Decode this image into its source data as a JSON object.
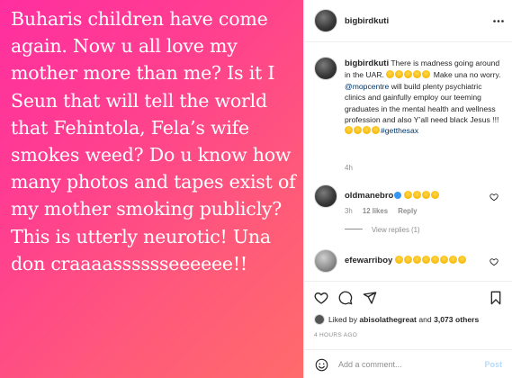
{
  "post": {
    "story_text": "Buharis children have come again. Now u all love my mother more than me? Is it I Seun that will tell the world that Fehintola, Fela’s wife smokes weed? Do u know how many photos and tapes exist of my mother smoking publicly? This is utterly neurotic! Una don craaaasssssseeeeee!!"
  },
  "header": {
    "username": "bigbirdkuti"
  },
  "caption": {
    "username": "bigbirdkuti",
    "text_a": "There is madness going around in the UAR.",
    "text_b": "Make una no worry.",
    "mention": "@mopcentre",
    "text_c": "will build plenty psychiatric clinics and gainfully employ our teeming graduates in the mental health and wellness profession and also Y’all need black Jesus !!!",
    "hashtag": "#getthesax",
    "time": "4h"
  },
  "comments": [
    {
      "username": "oldmanebro",
      "time": "3h",
      "likes": "12 likes",
      "reply": "Reply",
      "view_replies": "View replies (1)"
    },
    {
      "username": "efewarriboy"
    }
  ],
  "likes": {
    "prefix": "Liked by",
    "user": "abisolathegreat",
    "and": "and",
    "count": "3,073 others"
  },
  "post_time": "4 HOURS AGO",
  "add_comment": {
    "placeholder": "Add a comment...",
    "post_label": "Post"
  },
  "colors": {
    "link": "#00376b",
    "muted": "#8e8e8e",
    "verified": "#3897f0"
  }
}
